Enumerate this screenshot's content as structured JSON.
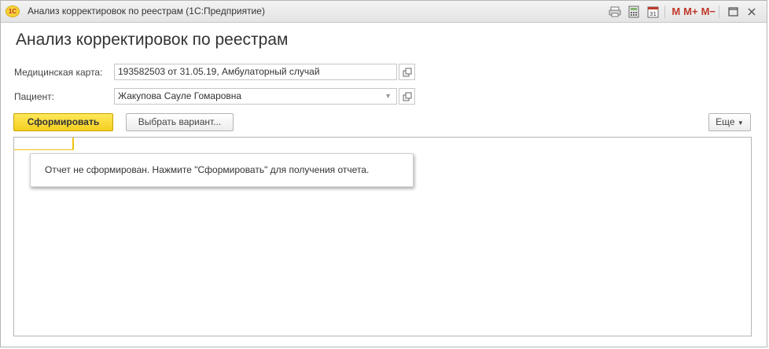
{
  "window": {
    "title": "Анализ корректировок по реестрам  (1С:Предприятие)",
    "logo_text": "1С",
    "memory_buttons": [
      "M",
      "M+",
      "M−"
    ]
  },
  "page": {
    "title": "Анализ корректировок по реестрам"
  },
  "form": {
    "medcard_label": "Медицинская карта:",
    "medcard_value": "193582503 от 31.05.19, Амбулаторный случай",
    "patient_label": "Пациент:",
    "patient_value": "Жакупова Сауле Гомаровна"
  },
  "toolbar": {
    "generate_label": "Сформировать",
    "choose_variant_label": "Выбрать вариант...",
    "more_label": "Еще"
  },
  "report": {
    "message": "Отчет не сформирован. Нажмите \"Сформировать\" для получения отчета."
  },
  "icons": [
    "app-logo-icon",
    "print-icon",
    "calculator-icon",
    "calendar-icon",
    "maximize-icon",
    "close-icon",
    "open-icon",
    "dropdown-arrow-icon",
    "chevron-down-icon"
  ],
  "colors": {
    "primary_button": "#f4cf1f",
    "accent_marker": "#f1c40f"
  }
}
